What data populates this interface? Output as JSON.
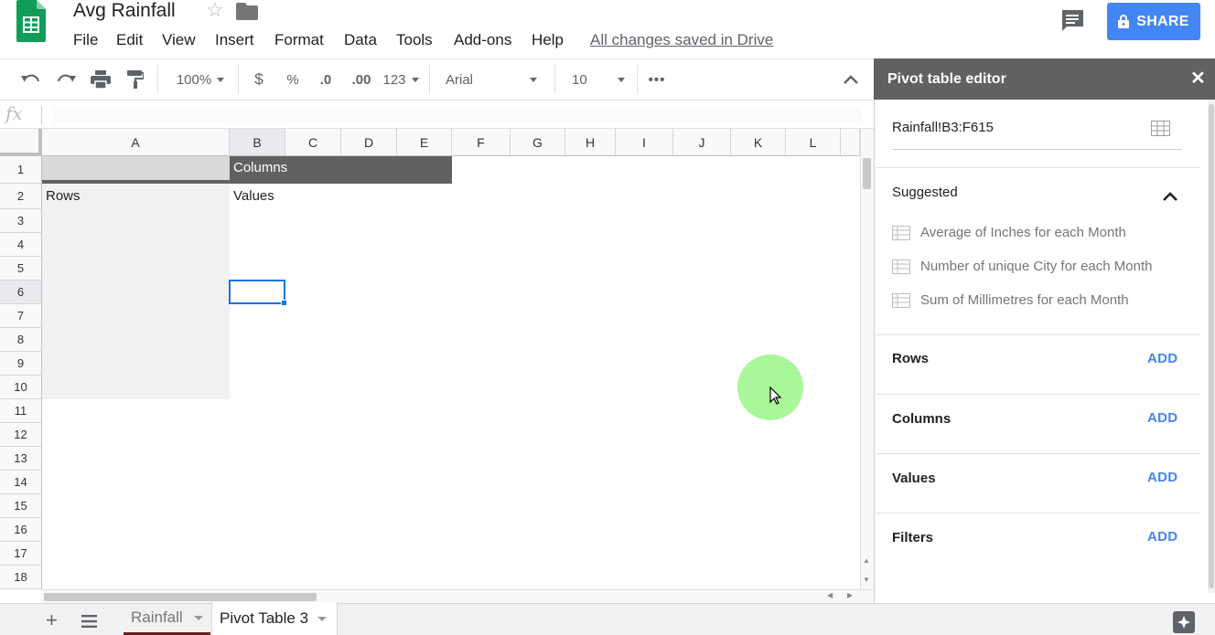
{
  "doc": {
    "title": "Avg Rainfall",
    "saved_status": "All changes saved in Drive",
    "share_label": "SHARE"
  },
  "menu": [
    "File",
    "Edit",
    "View",
    "Insert",
    "Format",
    "Data",
    "Tools",
    "Add-ons",
    "Help"
  ],
  "toolbar": {
    "zoom": "100%",
    "currency": "$",
    "percent": "%",
    "dec_decrease": ".0",
    "dec_increase": ".00",
    "more_formats": "123",
    "font": "Arial",
    "font_size": "10",
    "more": "•••"
  },
  "formula_bar": {
    "fx": "fx",
    "value": ""
  },
  "grid": {
    "columns": [
      "A",
      "B",
      "C",
      "D",
      "E",
      "F",
      "G",
      "H",
      "I",
      "J",
      "K",
      "L"
    ],
    "rows": [
      "1",
      "2",
      "3",
      "4",
      "5",
      "6",
      "7",
      "8",
      "9",
      "10",
      "11",
      "12",
      "13",
      "14",
      "15",
      "16",
      "17",
      "18"
    ],
    "selected_column": "B",
    "selected_row": "6",
    "cells": {
      "B1": "Columns",
      "A2": "Rows",
      "B2": "Values"
    }
  },
  "sheets": {
    "tabs": [
      "Rainfall",
      "Pivot Table 3"
    ],
    "active": "Pivot Table 3"
  },
  "pivot_editor": {
    "title": "Pivot table editor",
    "close": "✕",
    "range": "Rainfall!B3:F615",
    "suggested_label": "Suggested",
    "suggestions": [
      "Average of Inches for each Month",
      "Number of unique City for each Month",
      "Sum of Millimetres for each Month"
    ],
    "sections": [
      {
        "label": "Rows",
        "action": "ADD"
      },
      {
        "label": "Columns",
        "action": "ADD"
      },
      {
        "label": "Values",
        "action": "ADD"
      },
      {
        "label": "Filters",
        "action": "ADD"
      }
    ]
  },
  "colors": {
    "accent": "#4285f4",
    "panel_header": "#616161",
    "pivot_header_bg": "#616161",
    "pivot_rows_bg": "#f1f1f1",
    "selection": "#1a73e8",
    "pointer_highlight": "#a8f79a"
  }
}
